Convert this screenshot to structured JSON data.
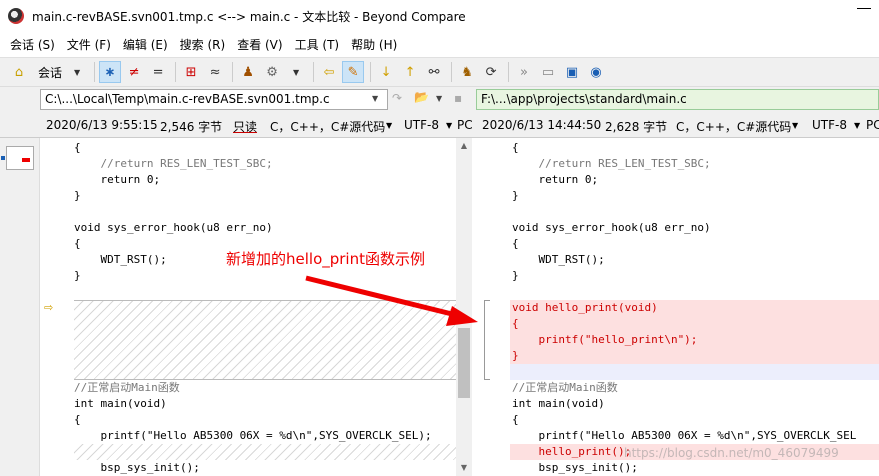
{
  "window": {
    "title": "main.c-revBASE.svn001.tmp.c <--> main.c - 文本比较 - Beyond Compare"
  },
  "menu": [
    "会话 (S)",
    "文件 (F)",
    "编辑 (E)",
    "搜索 (R)",
    "查看 (V)",
    "工具 (T)",
    "帮助 (H)"
  ],
  "toolbar": {
    "session_label": "会话"
  },
  "left": {
    "path": "C:\\...\\Local\\Temp\\main.c-revBASE.svn001.tmp.c",
    "date": "2020/6/13 9:55:15",
    "size": "2,546 字节",
    "readonly": "只读",
    "format": "C，C++，C#源代码",
    "encoding": "UTF-8",
    "lineend": "PC",
    "lines": [
      "{",
      "    //return RES_LEN_TEST_SBC;",
      "    return 0;",
      "}",
      "",
      "void sys_error_hook(u8 err_no)",
      "{",
      "    WDT_RST();",
      "}",
      "",
      "",
      "",
      "",
      "",
      "",
      "//正常启动Main函数",
      "int main(void)",
      "{",
      "    printf(\"Hello AB5300 06X = %d\\n\",SYS_OVERCLK_SEL);",
      "",
      "    bsp_sys_init();"
    ]
  },
  "right": {
    "path": "F:\\...\\app\\projects\\standard\\main.c",
    "date": "2020/6/13 14:44:50",
    "size": "2,628 字节",
    "format": "C，C++，C#源代码",
    "encoding": "UTF-8",
    "lineend": "PC",
    "lines": [
      "{",
      "    //return RES_LEN_TEST_SBC;",
      "    return 0;",
      "}",
      "",
      "void sys_error_hook(u8 err_no)",
      "{",
      "    WDT_RST();",
      "}",
      "",
      "void hello_print(void)",
      "{",
      "    printf(\"hello_print\\n\");",
      "}",
      "",
      "//正常启动Main函数",
      "int main(void)",
      "{",
      "    printf(\"Hello AB5300 06X = %d\\n\",SYS_OVERCLK_SEL",
      "    hello_print();",
      "    bsp_sys_init();"
    ]
  },
  "annotation": "新增加的hello_print函数示例",
  "watermark": "https://blog.csdn.net/m0_46079499"
}
